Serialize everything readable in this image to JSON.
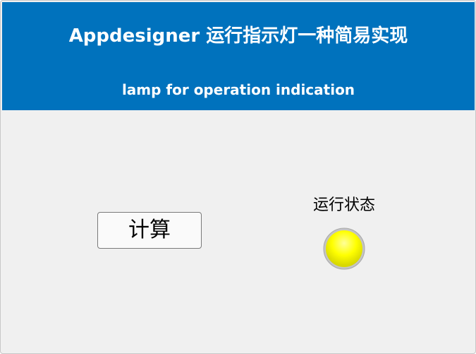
{
  "header": {
    "title": "Appdesigner 运行指示灯一种简易实现",
    "subtitle": "lamp for operation indication",
    "background_color": "#0072bd"
  },
  "controls": {
    "calc_button_label": "计算"
  },
  "lamp": {
    "label": "运行状态",
    "color": "#ffff00",
    "state": "on"
  }
}
